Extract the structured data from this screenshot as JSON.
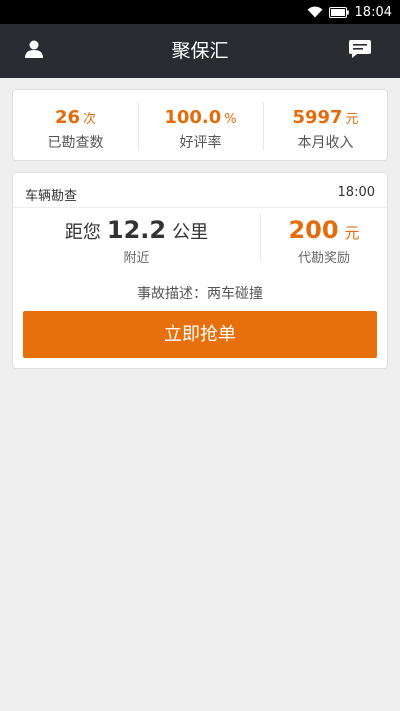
{
  "status_bar": {
    "time": "18:04",
    "icons": [
      "wifi-icon",
      "battery-icon"
    ]
  },
  "nav": {
    "title": "聚保汇",
    "left_icon": "user-icon",
    "right_icon": "message-icon"
  },
  "stats": [
    {
      "value": "26",
      "unit": "次",
      "label": "已勘查数"
    },
    {
      "value": "100.0",
      "unit": "%",
      "label": "好评率"
    },
    {
      "value": "5997",
      "unit": "元",
      "label": "本月收入"
    }
  ],
  "order": {
    "type": "车辆勘查",
    "time": "18:00",
    "distance_prefix": "距您",
    "distance_value": "12.2",
    "distance_unit": "公里",
    "distance_label": "附近",
    "reward_value": "200",
    "reward_unit": "元",
    "reward_label": "代勘奖励",
    "description": "事故描述：两车碰撞",
    "button_label": "立即抢单"
  },
  "colors": {
    "accent": "#e46c0a",
    "nav_bg": "#2b2c31",
    "page_bg": "#efefef"
  }
}
